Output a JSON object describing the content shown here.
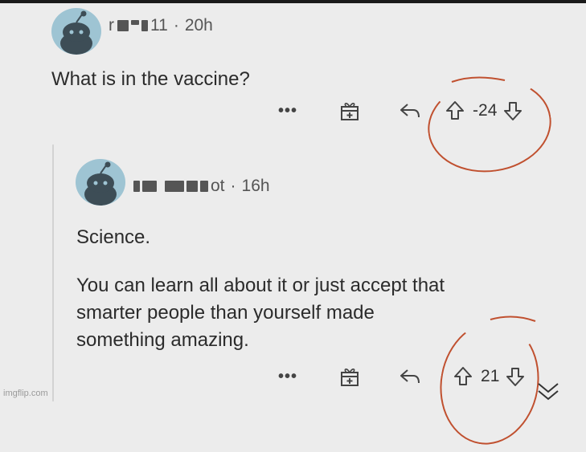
{
  "comment1": {
    "username_visible_start": "r",
    "username_visible_end": "11",
    "separator": "·",
    "time": "20h",
    "text": "What is in the vaccine?",
    "actions": {
      "more": "•••",
      "score": "-24"
    }
  },
  "comment2": {
    "username_visible_end": "ot",
    "separator": "·",
    "time": "16h",
    "paragraph1": "Science.",
    "paragraph2_line1": "You can learn all about it or just accept that",
    "paragraph2_line2": "smarter people than yourself made",
    "paragraph2_line3": "something amazing.",
    "actions": {
      "more": "•••",
      "score": "21"
    }
  },
  "watermark": "imgflip.com",
  "colors": {
    "avatar": "#9ec4d3",
    "annotation": "#c0502f",
    "background": "#ececec"
  },
  "icons": [
    "snoo-avatar-icon",
    "award-gift-icon",
    "reply-arrow-icon",
    "upvote-arrow-icon",
    "downvote-arrow-icon"
  ]
}
